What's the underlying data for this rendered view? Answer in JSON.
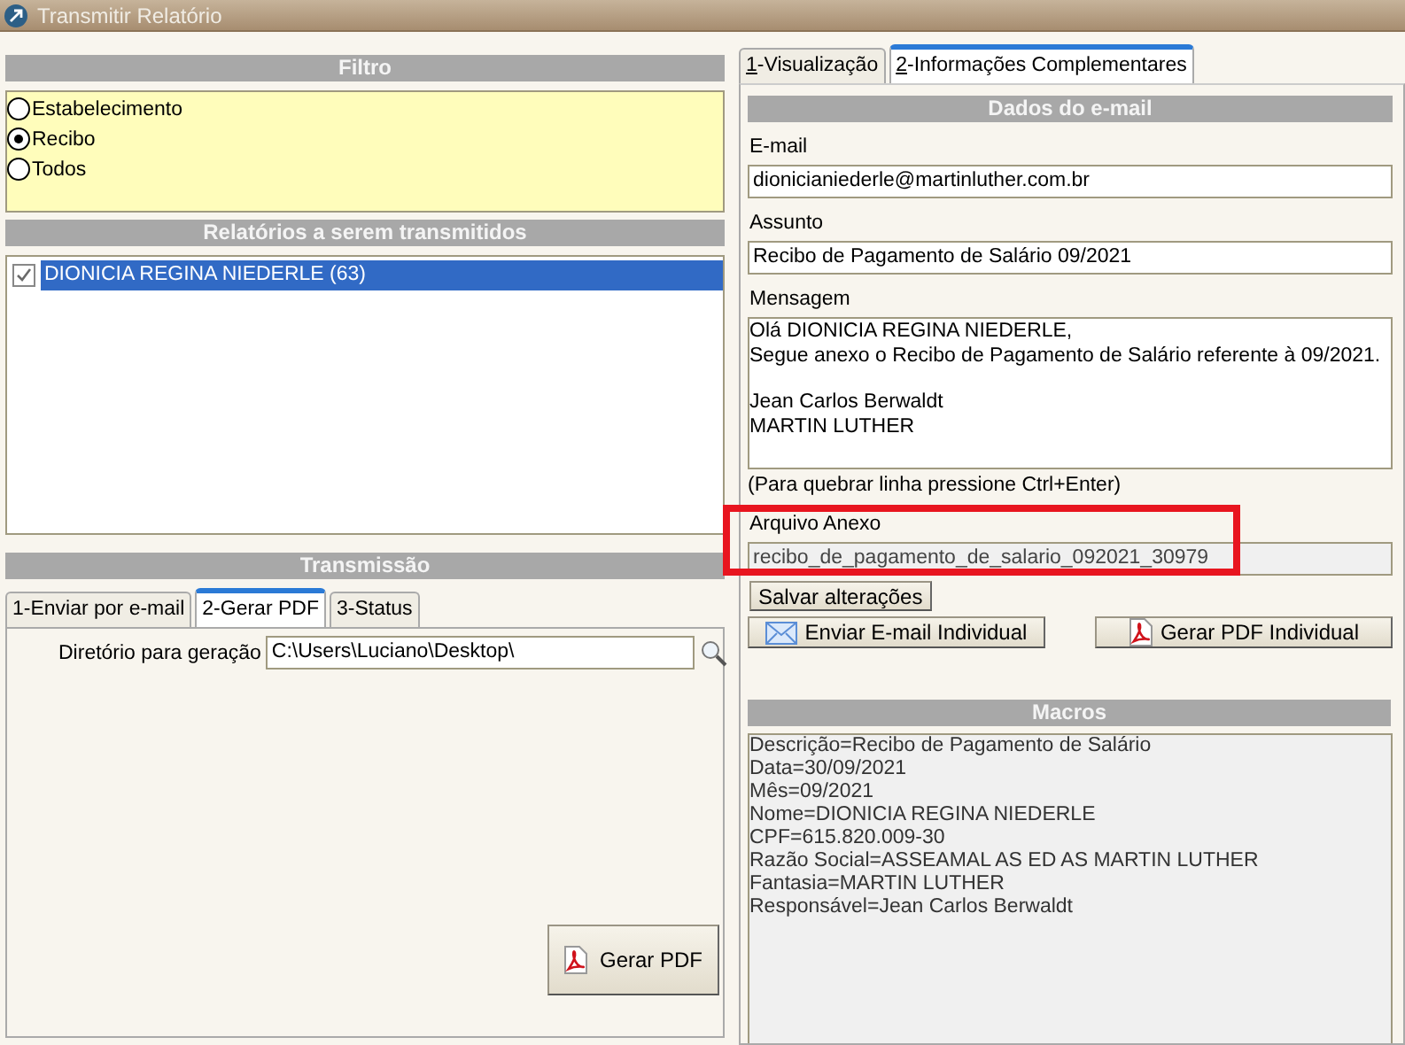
{
  "window": {
    "title": "Transmitir Relatório"
  },
  "filter": {
    "title": "Filtro",
    "options": [
      {
        "label": "Estabelecimento",
        "selected": false
      },
      {
        "label": "Recibo",
        "selected": true
      },
      {
        "label": "Todos",
        "selected": false
      }
    ]
  },
  "reports": {
    "title": "Relatórios a serem transmitidos",
    "items": [
      {
        "label": "DIONICIA REGINA NIEDERLE (63)",
        "checked": true,
        "selected": true
      }
    ]
  },
  "transmission": {
    "title": "Transmissão",
    "tabs": [
      {
        "label": "1-Enviar por e-mail",
        "selected": false
      },
      {
        "label": "2-Gerar PDF",
        "selected": true
      },
      {
        "label": "3-Status",
        "selected": false
      }
    ],
    "directory_label": "Diretório para geração",
    "directory_value": "C:\\Users\\Luciano\\Desktop\\",
    "generate_button": "Gerar PDF"
  },
  "right_tabs": [
    {
      "label": "1-Visualização",
      "selected": false
    },
    {
      "label": "2-Informações Complementares",
      "selected": true
    }
  ],
  "email_data": {
    "title": "Dados do e-mail",
    "email_label": "E-mail",
    "email_value": "dionicianiederle@martinluther.com.br",
    "subject_label": "Assunto",
    "subject_value": "Recibo de Pagamento de Salário 09/2021",
    "message_label": "Mensagem",
    "message_paragraphs": [
      [
        "Olá DIONICIA REGINA NIEDERLE,",
        "Segue anexo o Recibo de Pagamento de Salário referente à 09/2021."
      ],
      [
        "Jean Carlos Berwaldt",
        "MARTIN LUTHER"
      ]
    ],
    "hint": "(Para quebrar linha pressione Ctrl+Enter)",
    "attachment_label": "Arquivo Anexo",
    "attachment_value": "recibo_de_pagamento_de_salario_092021_30979",
    "attachment_highlighted": true,
    "save_button": "Salvar alterações",
    "email_button": "Enviar E-mail Individual",
    "pdf_button": "Gerar PDF Individual"
  },
  "macros": {
    "title": "Macros",
    "lines": [
      "Descrição=Recibo de Pagamento de Salário",
      "Data=30/09/2021",
      "Mês=09/2021",
      "Nome=DIONICIA REGINA NIEDERLE",
      "CPF=615.820.009-30",
      "Razão Social=ASSEAMAL AS ED AS MARTIN LUTHER",
      "Fantasia=MARTIN LUTHER",
      "Responsável=Jean Carlos Berwaldt"
    ]
  }
}
